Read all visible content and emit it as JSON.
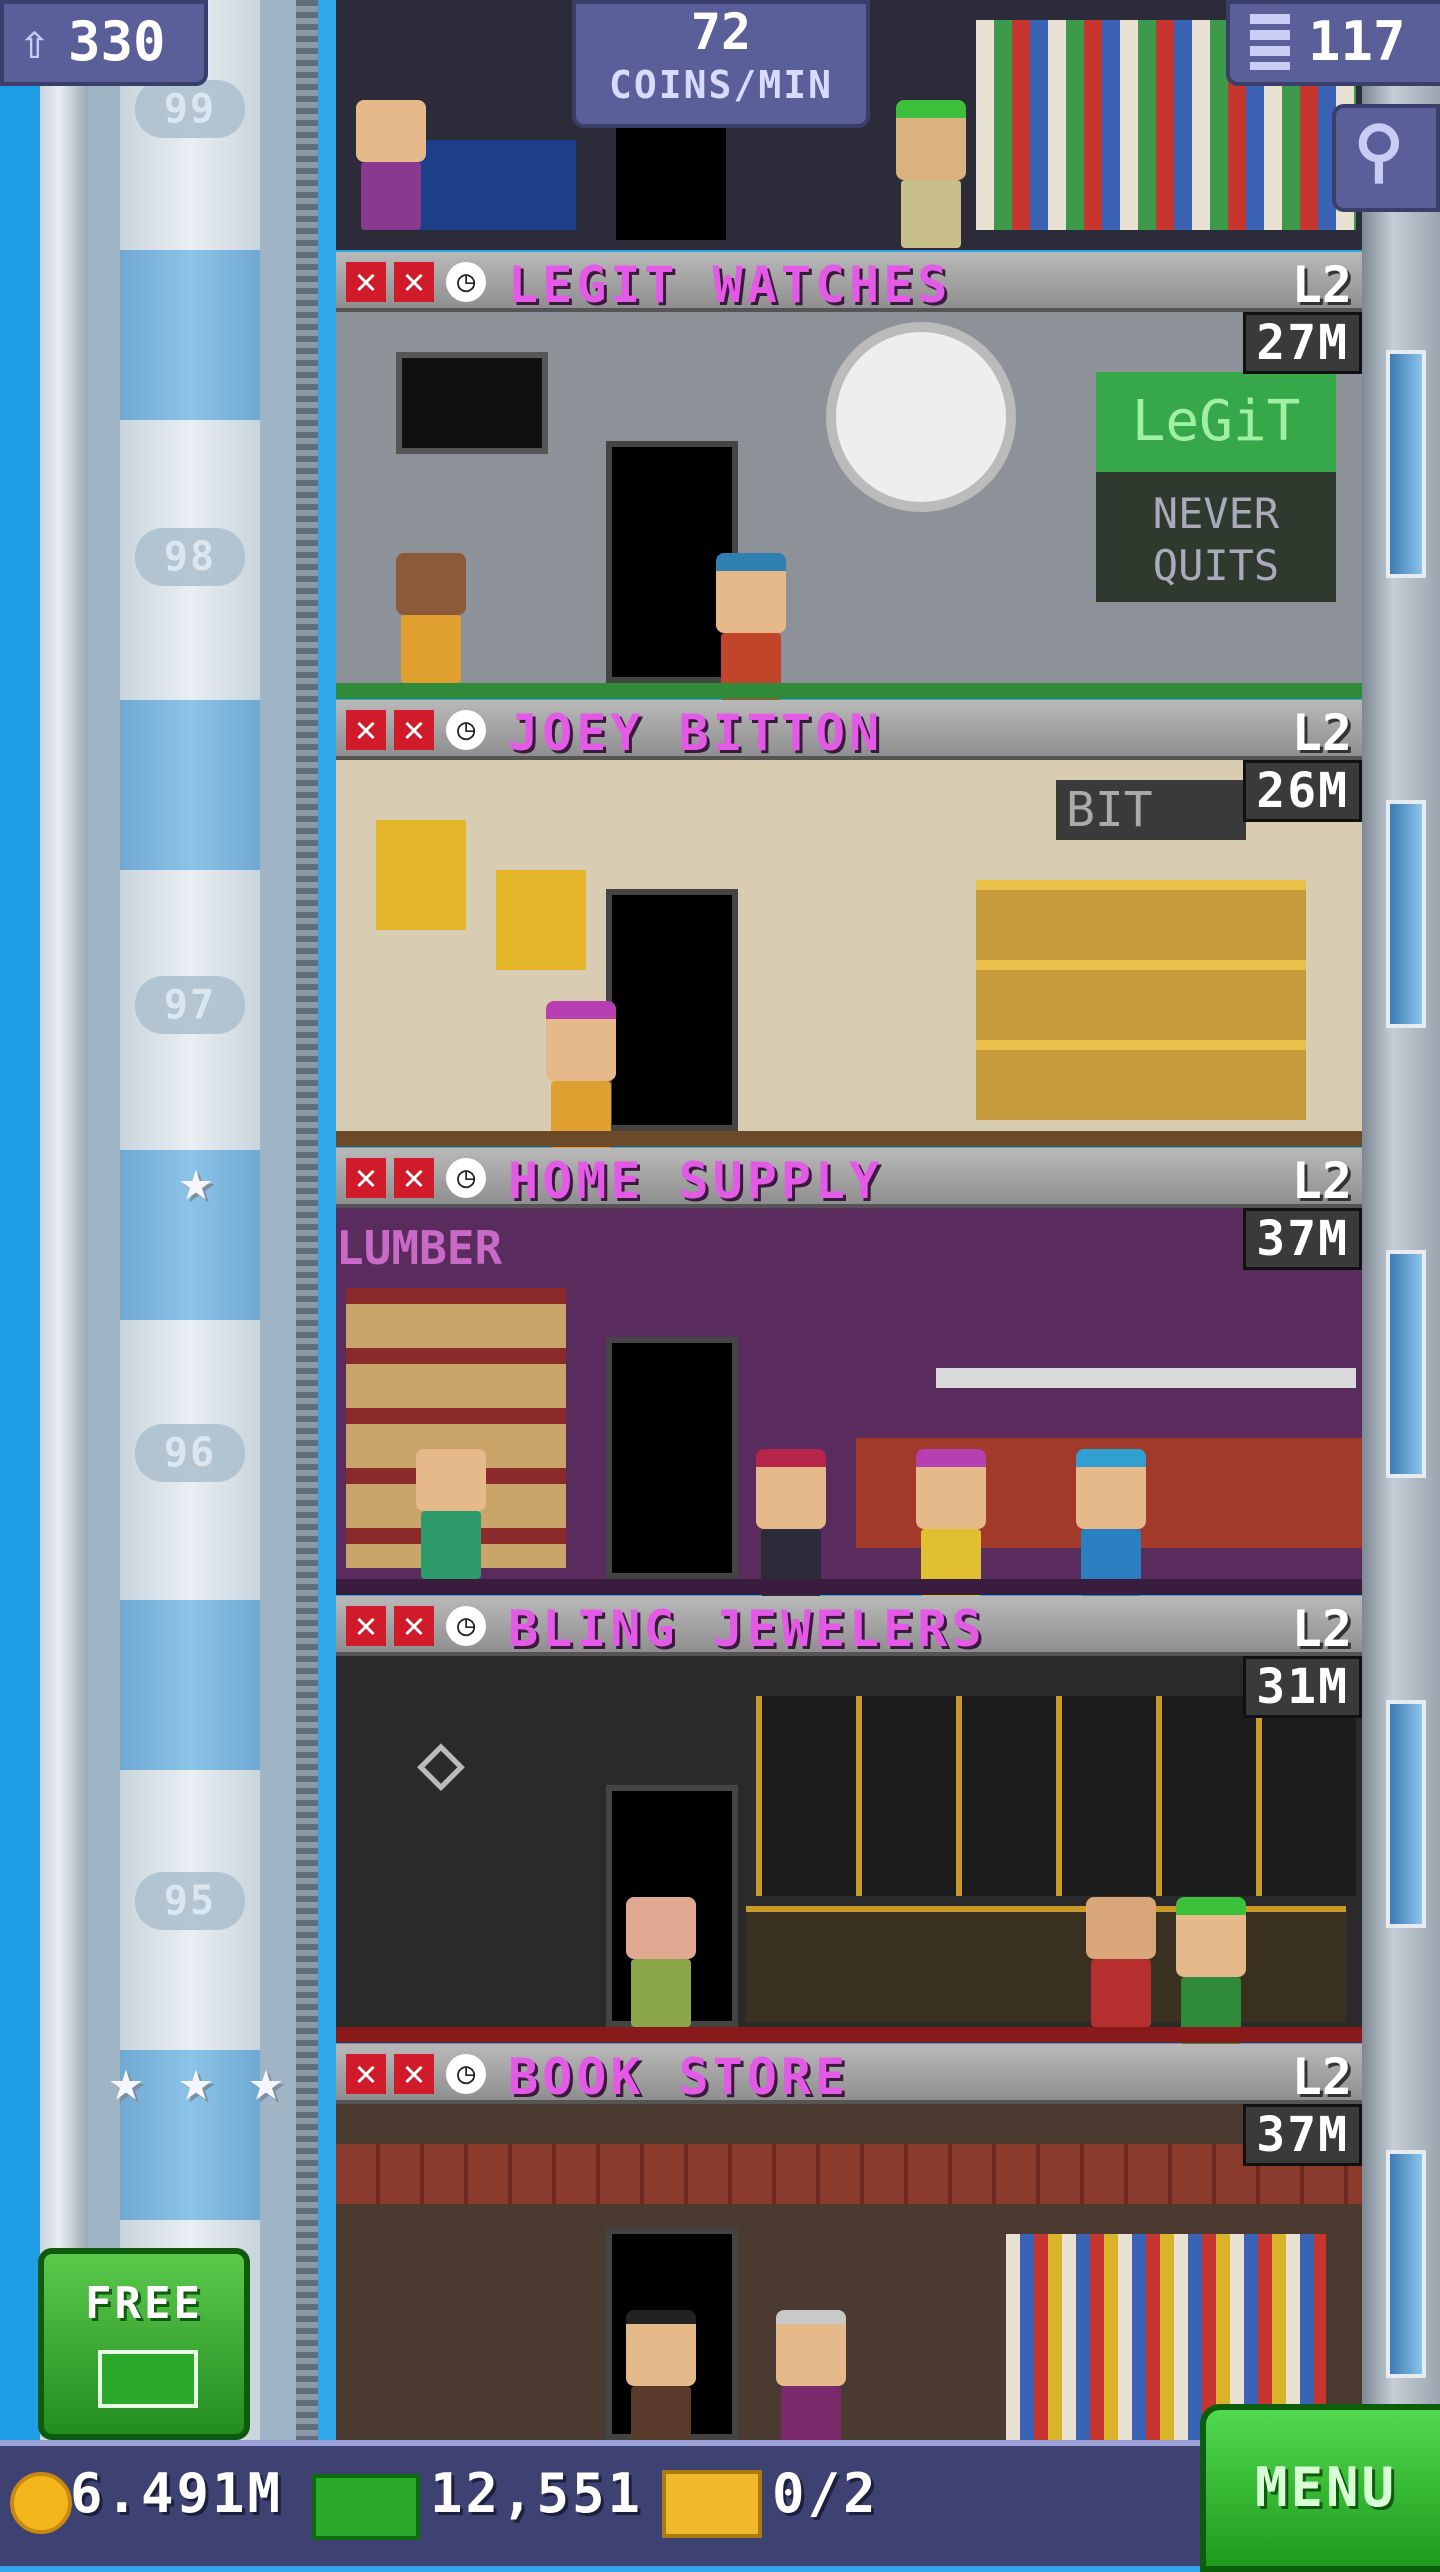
{
  "hud": {
    "population": "330",
    "coins_per_min_value": "72",
    "coins_per_min_label": "COINS/MIN",
    "floors_count": "117"
  },
  "shaft_floor_numbers": [
    "99",
    "98",
    "97",
    "96",
    "95"
  ],
  "floors": [
    {
      "name": "LEGIT WATCHES",
      "level": "L2",
      "stock": "27M",
      "sign_text_1": "LeGiT",
      "sign_text_2": "NEVER",
      "sign_text_3": "QUITS"
    },
    {
      "name": "JOEY BITTON",
      "level": "L2",
      "stock": "26M",
      "sign_text_1": "BIT"
    },
    {
      "name": "HOME SUPPLY",
      "level": "L2",
      "stock": "37M",
      "sign_text_1": "LUMBER"
    },
    {
      "name": "BLING JEWELERS",
      "level": "L2",
      "stock": "31M"
    },
    {
      "name": "BOOK STORE",
      "level": "L2",
      "stock": "37M"
    }
  ],
  "free_button": {
    "label": "FREE"
  },
  "bottom": {
    "coins": "6.491M",
    "bux": "12,551",
    "tickets": "0/2",
    "menu_label": "MENU"
  },
  "colors": {
    "floor_name": "#e35ae6",
    "menu_green": "#2fbf2a",
    "hud_purple": "#5a5f99"
  }
}
